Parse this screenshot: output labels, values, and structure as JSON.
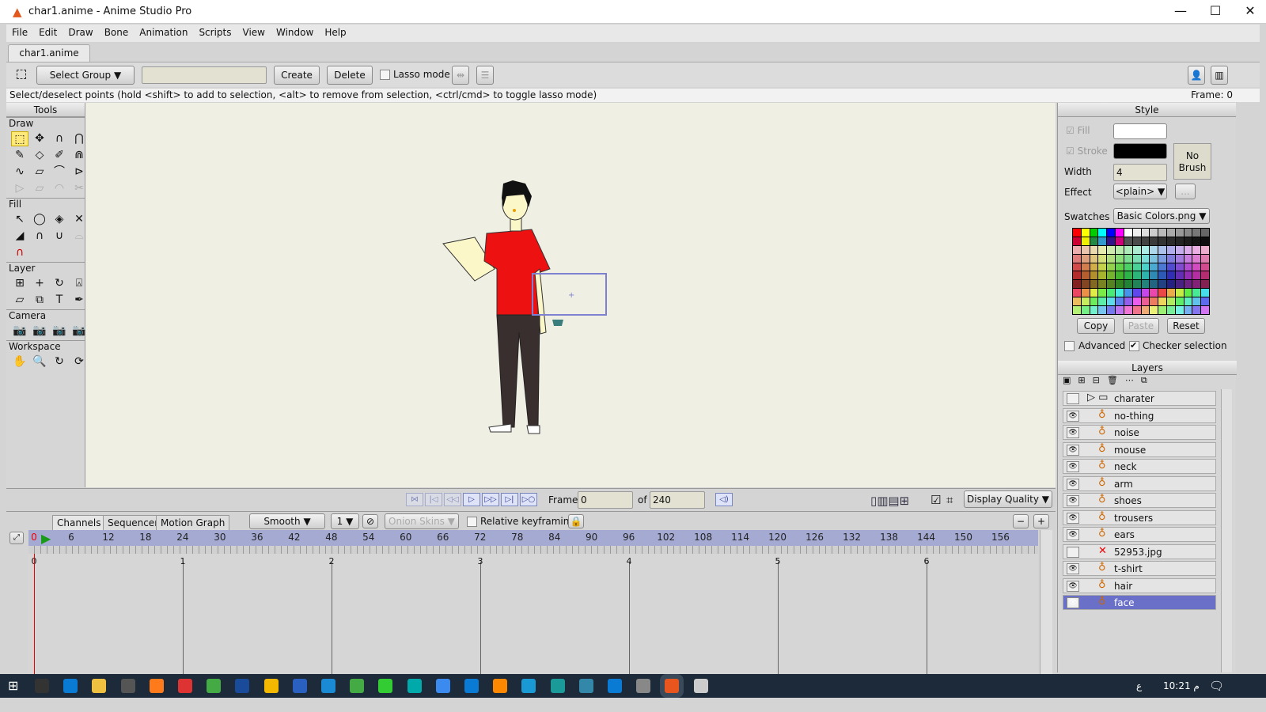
{
  "window": {
    "title": "char1.anime - Anime Studio Pro",
    "minimize": "—",
    "maximize": "☐",
    "close": "✕"
  },
  "menu": [
    "File",
    "Edit",
    "Draw",
    "Bone",
    "Animation",
    "Scripts",
    "View",
    "Window",
    "Help"
  ],
  "doc_tab": "char1.anime",
  "toolbar": {
    "select_group": "Select Group",
    "group_name": "",
    "create": "Create",
    "delete": "Delete",
    "lasso_mode": "Lasso mode"
  },
  "status": {
    "hint": "Select/deselect points (hold <shift> to add to selection, <alt> to remove from selection, <ctrl/cmd> to toggle lasso mode)",
    "frame": "Frame: 0"
  },
  "tools": {
    "title": "Tools",
    "sections": [
      "Draw",
      "Fill",
      "Layer",
      "Camera",
      "Workspace"
    ]
  },
  "style": {
    "title": "Style",
    "fill_label": "Fill",
    "stroke_label": "Stroke",
    "fill_color": "#ffffff",
    "stroke_color": "#000000",
    "width_label": "Width",
    "width": "4",
    "effect_label": "Effect",
    "effect": "<plain>",
    "effect_more": "...",
    "no_brush": "No Brush",
    "swatches_label": "Swatches",
    "swatches": "Basic Colors.png",
    "copy": "Copy",
    "paste": "Paste",
    "reset": "Reset",
    "advanced": "Advanced",
    "checker": "Checker selection"
  },
  "layers": {
    "title": "Layers",
    "items": [
      {
        "name": "charater",
        "type": "group",
        "visible": false
      },
      {
        "name": "no-thing",
        "type": "bone",
        "visible": true
      },
      {
        "name": "noise",
        "type": "bone",
        "visible": true
      },
      {
        "name": "mouse",
        "type": "bone",
        "visible": true
      },
      {
        "name": "neck",
        "type": "bone",
        "visible": true
      },
      {
        "name": "arm",
        "type": "bone",
        "visible": true
      },
      {
        "name": "shoes",
        "type": "bone",
        "visible": true
      },
      {
        "name": "trousers",
        "type": "bone",
        "visible": true
      },
      {
        "name": "ears",
        "type": "bone",
        "visible": true
      },
      {
        "name": "52953.jpg",
        "type": "image-missing",
        "visible": false
      },
      {
        "name": "t-shirt",
        "type": "bone",
        "visible": true
      },
      {
        "name": "hair",
        "type": "bone",
        "visible": true
      },
      {
        "name": "face",
        "type": "bone",
        "visible": true,
        "selected": true
      }
    ]
  },
  "playback": {
    "frame_label": "Frame",
    "frame": "0",
    "of_label": "of",
    "total": "240",
    "display_quality": "Display Quality"
  },
  "timeline": {
    "tabs": [
      "Channels",
      "Sequencer",
      "Motion Graph"
    ],
    "interp": "Smooth",
    "interp_count": "1",
    "onion": "Onion Skins",
    "relative": "Relative keyframing",
    "ruler": [
      "0",
      "6",
      "12",
      "18",
      "24",
      "30",
      "36",
      "42",
      "48",
      "54",
      "60",
      "66",
      "72",
      "78",
      "84",
      "90",
      "96",
      "102",
      "108",
      "114",
      "120",
      "126",
      "132",
      "138",
      "144",
      "150",
      "156"
    ],
    "seconds": [
      "0",
      "1",
      "2",
      "3",
      "4",
      "5",
      "6"
    ]
  },
  "taskbar": {
    "time": "10:21 م",
    "lang": "ع"
  }
}
